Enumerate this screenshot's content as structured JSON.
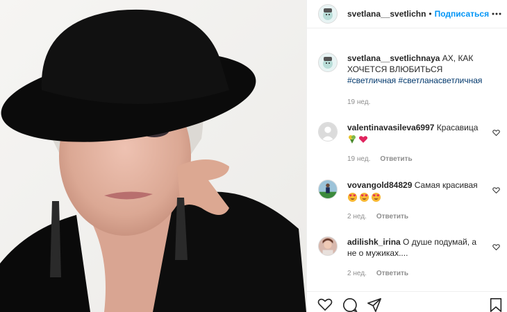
{
  "header": {
    "username": "svetlana__svetlichn",
    "separator": "•",
    "follow_label": "Подписаться"
  },
  "caption": {
    "username": "svetlana__svetlichnaya",
    "text": "АХ, КАК ХОЧЕТСЯ ВЛЮБИТЬСЯ",
    "hashtag1": "#светличная",
    "hashtag2": "#светланасветличная",
    "time": "19 нед."
  },
  "comments": [
    {
      "username": "valentinavasileva6997",
      "text": "Красавица",
      "emoji": [
        "bouquet",
        "red-heart"
      ],
      "time": "19 нед.",
      "reply_label": "Ответить"
    },
    {
      "username": "vovangold84829",
      "text": "Самая красивая",
      "emoji": [
        "heart-eyes",
        "heart-eyes",
        "heart-eyes"
      ],
      "time": "2 нед.",
      "reply_label": "Ответить"
    },
    {
      "username": "adilishk_irina",
      "text": "О душе подумай, а не о мужиках....",
      "time": "2 нед.",
      "reply_label": "Ответить"
    }
  ],
  "icons": {
    "like": "heart-icon",
    "comment": "comment-icon",
    "share": "share-icon",
    "save": "bookmark-icon",
    "more": "more-icon"
  },
  "colors": {
    "link": "#0095f6",
    "hashtag": "#00376b",
    "meta": "#8e8e8e",
    "emoji_heart": "#e0245e"
  }
}
